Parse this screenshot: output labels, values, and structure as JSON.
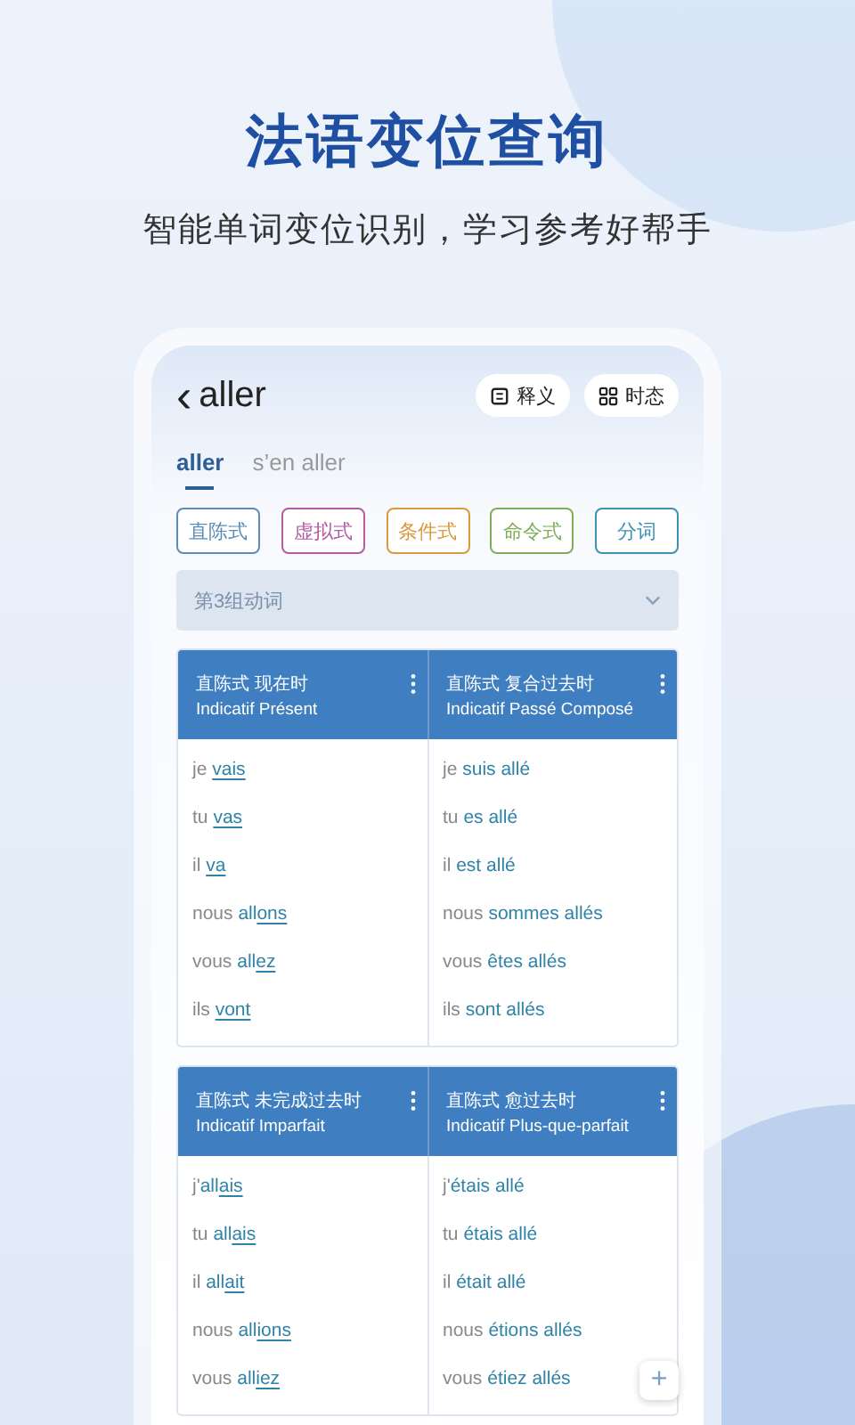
{
  "headline": "法语变位查询",
  "subtitle": "智能单词变位识别，学习参考好帮手",
  "screen": {
    "back": "‹",
    "word": "aller",
    "actions": [
      {
        "kind": "definition",
        "label": "释义"
      },
      {
        "kind": "tenses",
        "label": "时态"
      }
    ],
    "tabs": [
      {
        "label": "aller",
        "selected": true
      },
      {
        "label": "s’en aller",
        "selected": false
      }
    ],
    "moods": [
      {
        "label": "直陈式",
        "color": "#5b8db8"
      },
      {
        "label": "虚拟式",
        "color": "#b35ca0"
      },
      {
        "label": "条件式",
        "color": "#d99a3c"
      },
      {
        "label": "命令式",
        "color": "#7fae5a"
      },
      {
        "label": "分词",
        "color": "#3f90b5"
      }
    ],
    "group": {
      "label": "第3组动词",
      "expanded": false
    },
    "tables": [
      {
        "columns": [
          {
            "title_zh": "直陈式 现在时",
            "title_fr": "Indicatif Présent",
            "forms": [
              {
                "pronoun": "je",
                "ending": "vais"
              },
              {
                "pronoun": "tu",
                "ending": "vas"
              },
              {
                "pronoun": "il",
                "ending": "va"
              },
              {
                "pronoun": "nous",
                "stem": "all",
                "ending": "ons"
              },
              {
                "pronoun": "vous",
                "stem": "all",
                "ending": "ez"
              },
              {
                "pronoun": "ils",
                "ending": "vont"
              }
            ]
          },
          {
            "title_zh": "直陈式 复合过去时",
            "title_fr": "Indicatif Passé Composé",
            "forms": [
              {
                "pronoun": "je",
                "stem": "suis allé"
              },
              {
                "pronoun": "tu",
                "stem": "es allé"
              },
              {
                "pronoun": "il",
                "stem": "est allé"
              },
              {
                "pronoun": "nous",
                "stem": "sommes allés"
              },
              {
                "pronoun": "vous",
                "stem": "êtes allés"
              },
              {
                "pronoun": "ils",
                "stem": "sont allés"
              }
            ]
          }
        ]
      },
      {
        "columns": [
          {
            "title_zh": "直陈式 未完成过去时",
            "title_fr": "Indicatif Imparfait",
            "forms": [
              {
                "pronoun": "j'",
                "stem": "all",
                "ending": "ais",
                "joined": true
              },
              {
                "pronoun": "tu",
                "stem": "all",
                "ending": "ais"
              },
              {
                "pronoun": "il",
                "stem": "all",
                "ending": "ait"
              },
              {
                "pronoun": "nous",
                "stem": "all",
                "ending": "ions"
              },
              {
                "pronoun": "vous",
                "stem": "all",
                "ending": "iez"
              }
            ]
          },
          {
            "title_zh": "直陈式 愈过去时",
            "title_fr": "Indicatif Plus-que-parfait",
            "forms": [
              {
                "pronoun": "j'",
                "stem": "étais allé",
                "joined": true
              },
              {
                "pronoun": "tu",
                "stem": "étais allé"
              },
              {
                "pronoun": "il",
                "stem": "était allé"
              },
              {
                "pronoun": "nous",
                "stem": "étions allés"
              },
              {
                "pronoun": "vous",
                "stem": "étiez allés"
              }
            ]
          }
        ]
      }
    ],
    "fab": "+"
  }
}
